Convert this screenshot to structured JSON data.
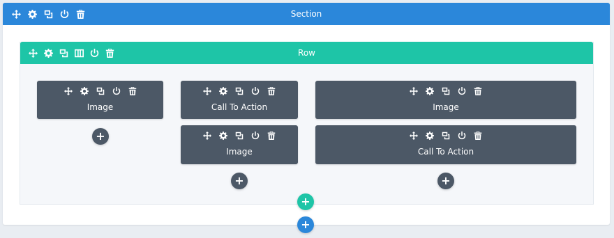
{
  "section": {
    "title": "Section"
  },
  "row": {
    "title": "Row"
  },
  "modules": [
    {
      "label": "Image"
    },
    {
      "label": "Call To Action"
    },
    {
      "label": "Image"
    },
    {
      "label": "Image"
    },
    {
      "label": "Call To Action"
    }
  ],
  "add_glyph": "+",
  "colors": {
    "section_header": "#2b87da",
    "row_header": "#1ec5a7",
    "module_bg": "#4c5866",
    "row_bg": "#f5f7fa",
    "page_bg": "#e9edf2"
  },
  "icons": {
    "section_controls": [
      "move-icon",
      "gear-icon",
      "duplicate-icon",
      "power-icon",
      "trash-icon"
    ],
    "row_controls": [
      "move-icon",
      "gear-icon",
      "duplicate-icon",
      "columns-icon",
      "power-icon",
      "trash-icon"
    ],
    "module_controls": [
      "move-icon",
      "gear-icon",
      "duplicate-icon",
      "power-icon",
      "trash-icon"
    ]
  }
}
